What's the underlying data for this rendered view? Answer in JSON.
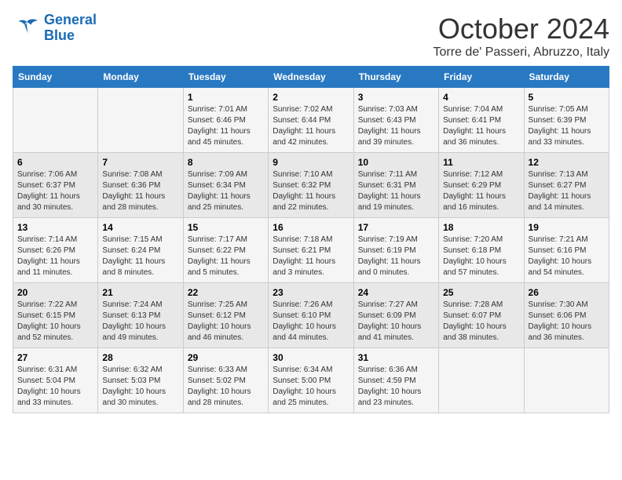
{
  "logo": {
    "line1": "General",
    "line2": "Blue"
  },
  "title": "October 2024",
  "location": "Torre de' Passeri, Abruzzo, Italy",
  "days_of_week": [
    "Sunday",
    "Monday",
    "Tuesday",
    "Wednesday",
    "Thursday",
    "Friday",
    "Saturday"
  ],
  "weeks": [
    [
      {
        "day": "",
        "sunrise": "",
        "sunset": "",
        "daylight": ""
      },
      {
        "day": "",
        "sunrise": "",
        "sunset": "",
        "daylight": ""
      },
      {
        "day": "1",
        "sunrise": "Sunrise: 7:01 AM",
        "sunset": "Sunset: 6:46 PM",
        "daylight": "Daylight: 11 hours and 45 minutes."
      },
      {
        "day": "2",
        "sunrise": "Sunrise: 7:02 AM",
        "sunset": "Sunset: 6:44 PM",
        "daylight": "Daylight: 11 hours and 42 minutes."
      },
      {
        "day": "3",
        "sunrise": "Sunrise: 7:03 AM",
        "sunset": "Sunset: 6:43 PM",
        "daylight": "Daylight: 11 hours and 39 minutes."
      },
      {
        "day": "4",
        "sunrise": "Sunrise: 7:04 AM",
        "sunset": "Sunset: 6:41 PM",
        "daylight": "Daylight: 11 hours and 36 minutes."
      },
      {
        "day": "5",
        "sunrise": "Sunrise: 7:05 AM",
        "sunset": "Sunset: 6:39 PM",
        "daylight": "Daylight: 11 hours and 33 minutes."
      }
    ],
    [
      {
        "day": "6",
        "sunrise": "Sunrise: 7:06 AM",
        "sunset": "Sunset: 6:37 PM",
        "daylight": "Daylight: 11 hours and 30 minutes."
      },
      {
        "day": "7",
        "sunrise": "Sunrise: 7:08 AM",
        "sunset": "Sunset: 6:36 PM",
        "daylight": "Daylight: 11 hours and 28 minutes."
      },
      {
        "day": "8",
        "sunrise": "Sunrise: 7:09 AM",
        "sunset": "Sunset: 6:34 PM",
        "daylight": "Daylight: 11 hours and 25 minutes."
      },
      {
        "day": "9",
        "sunrise": "Sunrise: 7:10 AM",
        "sunset": "Sunset: 6:32 PM",
        "daylight": "Daylight: 11 hours and 22 minutes."
      },
      {
        "day": "10",
        "sunrise": "Sunrise: 7:11 AM",
        "sunset": "Sunset: 6:31 PM",
        "daylight": "Daylight: 11 hours and 19 minutes."
      },
      {
        "day": "11",
        "sunrise": "Sunrise: 7:12 AM",
        "sunset": "Sunset: 6:29 PM",
        "daylight": "Daylight: 11 hours and 16 minutes."
      },
      {
        "day": "12",
        "sunrise": "Sunrise: 7:13 AM",
        "sunset": "Sunset: 6:27 PM",
        "daylight": "Daylight: 11 hours and 14 minutes."
      }
    ],
    [
      {
        "day": "13",
        "sunrise": "Sunrise: 7:14 AM",
        "sunset": "Sunset: 6:26 PM",
        "daylight": "Daylight: 11 hours and 11 minutes."
      },
      {
        "day": "14",
        "sunrise": "Sunrise: 7:15 AM",
        "sunset": "Sunset: 6:24 PM",
        "daylight": "Daylight: 11 hours and 8 minutes."
      },
      {
        "day": "15",
        "sunrise": "Sunrise: 7:17 AM",
        "sunset": "Sunset: 6:22 PM",
        "daylight": "Daylight: 11 hours and 5 minutes."
      },
      {
        "day": "16",
        "sunrise": "Sunrise: 7:18 AM",
        "sunset": "Sunset: 6:21 PM",
        "daylight": "Daylight: 11 hours and 3 minutes."
      },
      {
        "day": "17",
        "sunrise": "Sunrise: 7:19 AM",
        "sunset": "Sunset: 6:19 PM",
        "daylight": "Daylight: 11 hours and 0 minutes."
      },
      {
        "day": "18",
        "sunrise": "Sunrise: 7:20 AM",
        "sunset": "Sunset: 6:18 PM",
        "daylight": "Daylight: 10 hours and 57 minutes."
      },
      {
        "day": "19",
        "sunrise": "Sunrise: 7:21 AM",
        "sunset": "Sunset: 6:16 PM",
        "daylight": "Daylight: 10 hours and 54 minutes."
      }
    ],
    [
      {
        "day": "20",
        "sunrise": "Sunrise: 7:22 AM",
        "sunset": "Sunset: 6:15 PM",
        "daylight": "Daylight: 10 hours and 52 minutes."
      },
      {
        "day": "21",
        "sunrise": "Sunrise: 7:24 AM",
        "sunset": "Sunset: 6:13 PM",
        "daylight": "Daylight: 10 hours and 49 minutes."
      },
      {
        "day": "22",
        "sunrise": "Sunrise: 7:25 AM",
        "sunset": "Sunset: 6:12 PM",
        "daylight": "Daylight: 10 hours and 46 minutes."
      },
      {
        "day": "23",
        "sunrise": "Sunrise: 7:26 AM",
        "sunset": "Sunset: 6:10 PM",
        "daylight": "Daylight: 10 hours and 44 minutes."
      },
      {
        "day": "24",
        "sunrise": "Sunrise: 7:27 AM",
        "sunset": "Sunset: 6:09 PM",
        "daylight": "Daylight: 10 hours and 41 minutes."
      },
      {
        "day": "25",
        "sunrise": "Sunrise: 7:28 AM",
        "sunset": "Sunset: 6:07 PM",
        "daylight": "Daylight: 10 hours and 38 minutes."
      },
      {
        "day": "26",
        "sunrise": "Sunrise: 7:30 AM",
        "sunset": "Sunset: 6:06 PM",
        "daylight": "Daylight: 10 hours and 36 minutes."
      }
    ],
    [
      {
        "day": "27",
        "sunrise": "Sunrise: 6:31 AM",
        "sunset": "Sunset: 5:04 PM",
        "daylight": "Daylight: 10 hours and 33 minutes."
      },
      {
        "day": "28",
        "sunrise": "Sunrise: 6:32 AM",
        "sunset": "Sunset: 5:03 PM",
        "daylight": "Daylight: 10 hours and 30 minutes."
      },
      {
        "day": "29",
        "sunrise": "Sunrise: 6:33 AM",
        "sunset": "Sunset: 5:02 PM",
        "daylight": "Daylight: 10 hours and 28 minutes."
      },
      {
        "day": "30",
        "sunrise": "Sunrise: 6:34 AM",
        "sunset": "Sunset: 5:00 PM",
        "daylight": "Daylight: 10 hours and 25 minutes."
      },
      {
        "day": "31",
        "sunrise": "Sunrise: 6:36 AM",
        "sunset": "Sunset: 4:59 PM",
        "daylight": "Daylight: 10 hours and 23 minutes."
      },
      {
        "day": "",
        "sunrise": "",
        "sunset": "",
        "daylight": ""
      },
      {
        "day": "",
        "sunrise": "",
        "sunset": "",
        "daylight": ""
      }
    ]
  ]
}
